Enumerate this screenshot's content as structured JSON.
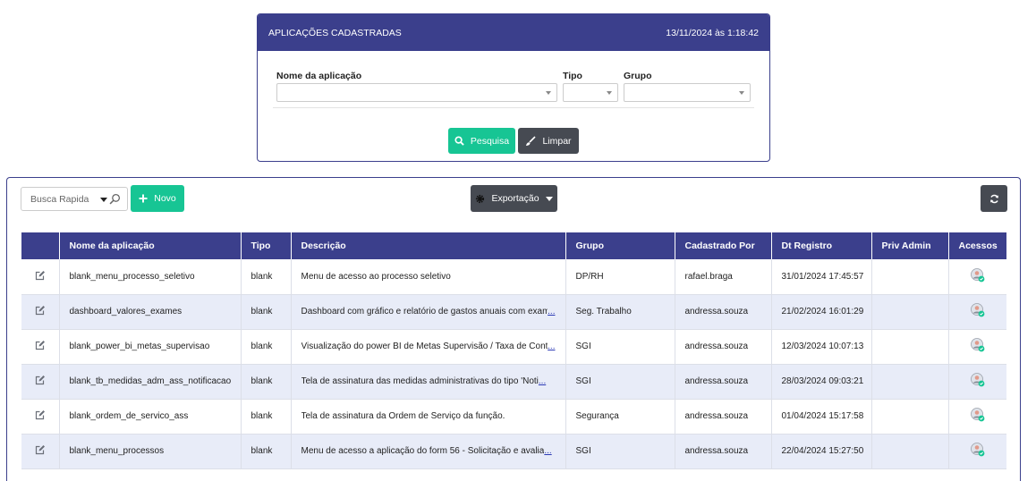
{
  "search_panel": {
    "title": "APLICAÇÕES CADASTRADAS",
    "datetime": "13/11/2024 às 1:18:42",
    "fields": {
      "app_name_label": "Nome da aplicação",
      "type_label": "Tipo",
      "group_label": "Grupo"
    },
    "search_button": "Pesquisa",
    "clear_button": "Limpar"
  },
  "toolbar": {
    "quick_search_placeholder": "Busca Rapida",
    "new_button": "Novo",
    "export_button": "Exportação"
  },
  "table": {
    "columns": [
      "Nome da aplicação",
      "Tipo",
      "Descrição",
      "Grupo",
      "Cadastrado Por",
      "Dt Registro",
      "Priv Admin",
      "Acessos"
    ],
    "rows": [
      {
        "name": "blank_menu_processo_seletivo",
        "type": "blank",
        "description": "Menu de acesso ao processo seletivo",
        "more": "",
        "group": "DP/RH",
        "by": "rafael.braga",
        "date": "31/01/2024 17:45:57",
        "admin": ""
      },
      {
        "name": "dashboard_valores_exames",
        "type": "blank",
        "description": "Dashboard com gráfico e relatório de gastos anuais com exame",
        "more": "...",
        "group": "Seg. Trabalho",
        "by": "andressa.souza",
        "date": "21/02/2024 16:01:29",
        "admin": ""
      },
      {
        "name": "blank_power_bi_metas_supervisao",
        "type": "blank",
        "description": "Visualização do power BI de Metas Supervisão / Taxa de Conta",
        "more": "...",
        "group": "SGI",
        "by": "andressa.souza",
        "date": "12/03/2024 10:07:13",
        "admin": ""
      },
      {
        "name": "blank_tb_medidas_adm_ass_notificacao",
        "type": "blank",
        "description": "Tela de assinatura das medidas administrativas do tipo 'Noti",
        "more": "...",
        "group": "SGI",
        "by": "andressa.souza",
        "date": "28/03/2024 09:03:21",
        "admin": ""
      },
      {
        "name": "blank_ordem_de_servico_ass",
        "type": "blank",
        "description": "Tela de assinatura da Ordem de Serviço da função.",
        "more": "",
        "group": "Segurança",
        "by": "andressa.souza",
        "date": "01/04/2024 15:17:58",
        "admin": ""
      },
      {
        "name": "blank_menu_processos",
        "type": "blank",
        "description": "Menu de acesso a aplicação do form 56 - Solicitação e avalia",
        "more": "...",
        "group": "SGI",
        "by": "andressa.souza",
        "date": "22/04/2024 15:27:50",
        "admin": ""
      }
    ]
  },
  "colors": {
    "primary": "#3b3f8c",
    "success": "#17c594",
    "dark": "#464a52",
    "row_alt": "#e8ecf8"
  }
}
